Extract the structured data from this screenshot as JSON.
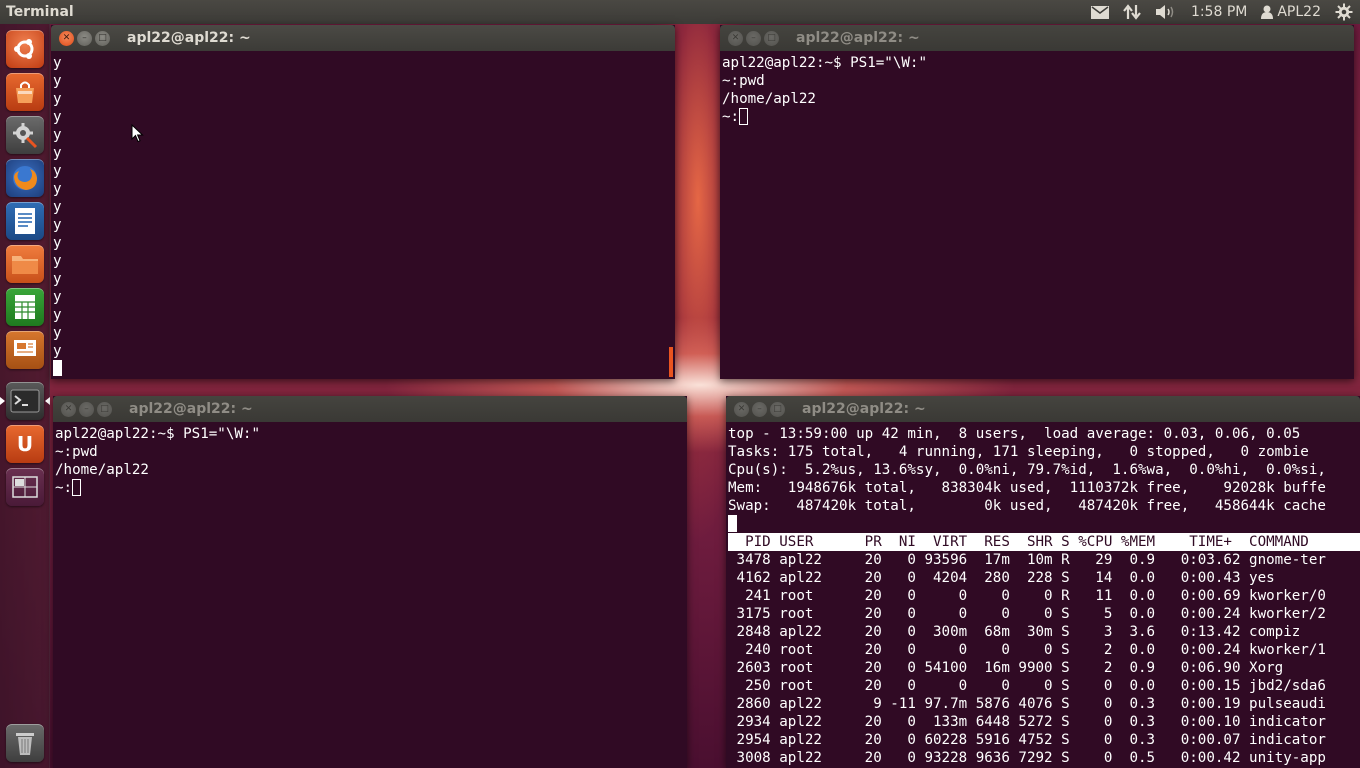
{
  "panel": {
    "app_title": "Terminal",
    "time": "1:58 PM",
    "user": "APL22",
    "icons": [
      "mail-icon",
      "network-transfer-icon",
      "volume-icon",
      "user-icon",
      "settings-gear-icon"
    ]
  },
  "launcher": {
    "items": [
      {
        "name": "dash-home",
        "icon": "ubuntu-logo-icon"
      },
      {
        "name": "software-center",
        "icon": "shopping-bag-icon"
      },
      {
        "name": "system-settings",
        "icon": "gear-wrench-icon"
      },
      {
        "name": "firefox",
        "icon": "firefox-icon"
      },
      {
        "name": "writer",
        "icon": "document-icon"
      },
      {
        "name": "files",
        "icon": "folder-icon"
      },
      {
        "name": "calc",
        "icon": "spreadsheet-icon"
      },
      {
        "name": "impress",
        "icon": "presentation-icon"
      },
      {
        "name": "terminal",
        "icon": "terminal-icon"
      },
      {
        "name": "ubuntu-one",
        "icon": "ubuntu-one-icon"
      },
      {
        "name": "workspaces",
        "icon": "workspace-switcher-icon"
      },
      {
        "name": "trash",
        "icon": "trash-icon"
      }
    ]
  },
  "windows": {
    "w1": {
      "title": "apl22@apl22: ~",
      "lines": [
        "y",
        "y",
        "y",
        "y",
        "y",
        "y",
        "y",
        "y",
        "y",
        "y",
        "y",
        "y",
        "y",
        "y",
        "y",
        "y",
        "y"
      ]
    },
    "w2": {
      "title": "apl22@apl22: ~",
      "lines": [
        "apl22@apl22:~$ PS1=\"\\W:\"",
        "~:pwd",
        "/home/apl22"
      ],
      "prompt": "~:"
    },
    "w3": {
      "title": "apl22@apl22: ~",
      "lines": [
        "apl22@apl22:~$ PS1=\"\\W:\"",
        "~:pwd",
        "/home/apl22"
      ],
      "prompt": "~:"
    },
    "w4": {
      "title": "apl22@apl22: ~",
      "summary": [
        "top - 13:59:00 up 42 min,  8 users,  load average: 0.03, 0.06, 0.05",
        "Tasks: 175 total,   4 running, 171 sleeping,   0 stopped,   0 zombie",
        "Cpu(s):  5.2%us, 13.6%sy,  0.0%ni, 79.7%id,  1.6%wa,  0.0%hi,  0.0%si,",
        "Mem:   1948676k total,   838304k used,  1110372k free,    92028k buffe",
        "Swap:   487420k total,        0k used,   487420k free,   458644k cache"
      ],
      "header": "  PID USER      PR  NI  VIRT  RES  SHR S %CPU %MEM    TIME+  COMMAND     ",
      "rows": [
        " 3478 apl22     20   0 93596  17m  10m R   29  0.9   0:03.62 gnome-ter",
        " 4162 apl22     20   0  4204  280  228 S   14  0.0   0:00.43 yes",
        "  241 root      20   0     0    0    0 R   11  0.0   0:00.69 kworker/0",
        " 3175 root      20   0     0    0    0 S    5  0.0   0:00.24 kworker/2",
        " 2848 apl22     20   0  300m  68m  30m S    3  3.6   0:13.42 compiz",
        "  240 root      20   0     0    0    0 S    2  0.0   0:00.24 kworker/1",
        " 2603 root      20   0 54100  16m 9900 S    2  0.9   0:06.90 Xorg",
        "  250 root      20   0     0    0    0 S    0  0.0   0:00.15 jbd2/sda6",
        " 2860 apl22      9 -11 97.7m 5876 4076 S    0  0.3   0:00.19 pulseaudi",
        " 2934 apl22     20   0  133m 6448 5272 S    0  0.3   0:00.10 indicator",
        " 2954 apl22     20   0 60228 5916 4752 S    0  0.3   0:00.07 indicator",
        " 3008 apl22     20   0 93228 9636 7292 S    0  0.5   0:00.42 unity-app"
      ]
    }
  },
  "colors": {
    "terminal_bg": "#300a24",
    "accent": "#e95420"
  }
}
